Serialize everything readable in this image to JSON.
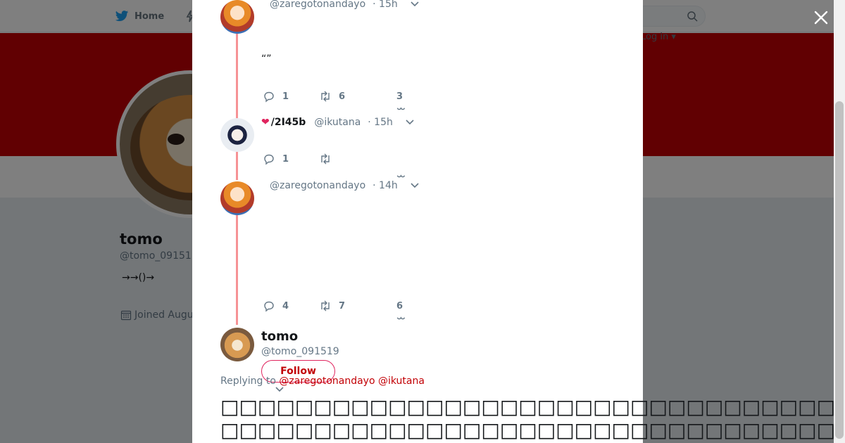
{
  "topnav": {
    "home_label": "Home",
    "login_label": "Log in ▾"
  },
  "profile": {
    "name": "tomo",
    "handle": "@tomo_09151",
    "bio": "→→()→",
    "joined": "Joined Augu"
  },
  "thread": [
    {
      "name": "",
      "handle": "@zaregotonandayo",
      "time": "· 15h",
      "text": "“”",
      "replies": "1",
      "retweets": "6",
      "likes": "3"
    },
    {
      "name": "/2I45b",
      "handle": "@ikutana",
      "time": "· 15h",
      "text": "",
      "replies": "1",
      "retweets": "",
      "likes": ""
    },
    {
      "name": "",
      "handle": "@zaregotonandayo",
      "time": "· 14h",
      "text": "",
      "replies": "4",
      "retweets": "7",
      "likes": "6"
    }
  ],
  "main_tweet": {
    "name": "tomo",
    "handle": "@tomo_091519",
    "follow_label": "Follow",
    "replying_prefix": "Replying to",
    "replying_to": [
      "@zaregotonandayo",
      "@ikutana"
    ],
    "text": "□□□□□□□□□□□□□□□□□□□□□□□□□□□□□□□□□□□□□□□□□□□□□□□□□□□□□□□□□□□□□□□□□□□□□□□□□□□□□□□□□□□"
  },
  "icons": {
    "close": "close-icon",
    "reply": "reply-icon",
    "retweet": "retweet-icon",
    "like": "heart-icon",
    "menu": "chevron-down-icon",
    "search": "search-icon",
    "calendar": "calendar-icon"
  },
  "colors": {
    "brand_red": "#c20005",
    "thread_line": "#f69295",
    "twitter_blue": "#1da1f2",
    "muted": "#657786"
  }
}
